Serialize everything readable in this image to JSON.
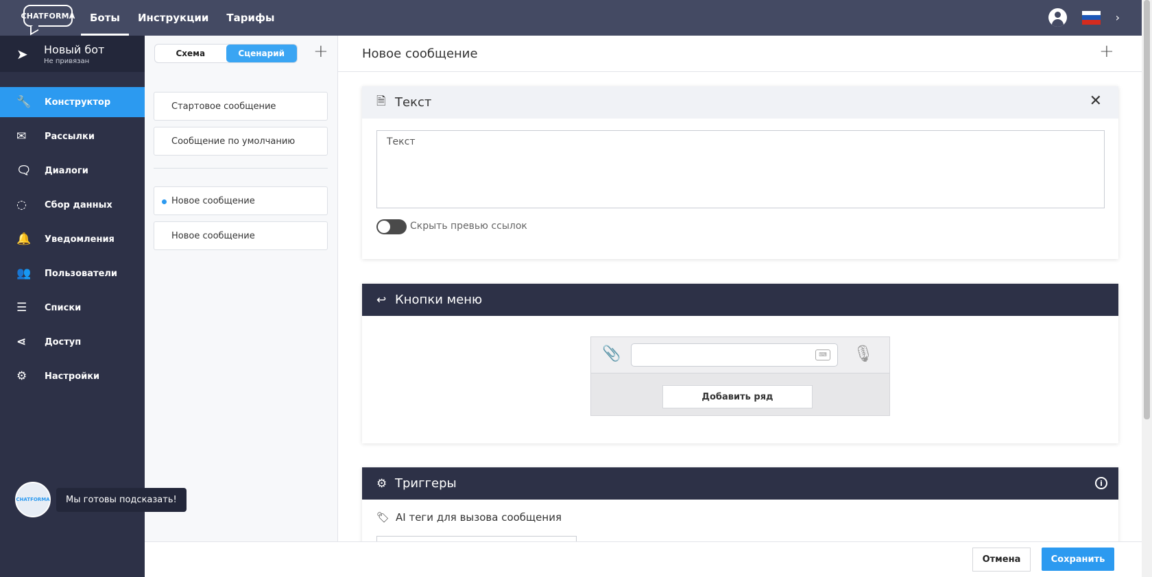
{
  "topbar": {
    "logo_text": "CHATFORMA",
    "nav": [
      {
        "label": "Боты",
        "active": true
      },
      {
        "label": "Инструкции",
        "active": false
      },
      {
        "label": "Тарифы",
        "active": false
      }
    ],
    "flag_colors": [
      "#ffffff",
      "#1c57b8",
      "#d52b1e"
    ],
    "chevron": "›"
  },
  "sidebar": {
    "bot_name": "Новый бот",
    "bot_status": "Не привязан",
    "items": [
      {
        "label": "Конструктор",
        "icon": "wrench-icon",
        "glyph": "🔧",
        "active": true
      },
      {
        "label": "Рассылки",
        "icon": "envelope-icon",
        "glyph": "✉",
        "active": false
      },
      {
        "label": "Диалоги",
        "icon": "chat-icon",
        "glyph": "🗨",
        "active": false
      },
      {
        "label": "Сбор данных",
        "icon": "chart-ring-icon",
        "glyph": "◌",
        "active": false
      },
      {
        "label": "Уведомления",
        "icon": "bell-icon",
        "glyph": "🔔",
        "active": false
      },
      {
        "label": "Пользователи",
        "icon": "users-icon",
        "glyph": "👥",
        "active": false
      },
      {
        "label": "Списки",
        "icon": "list-icon",
        "glyph": "☰",
        "active": false
      },
      {
        "label": "Доступ",
        "icon": "share-icon",
        "glyph": "⋖",
        "active": false
      },
      {
        "label": "Настройки",
        "icon": "gear-icon",
        "glyph": "⚙",
        "active": false
      }
    ],
    "help_avatar_text": "CHATFORMA",
    "help_text": "Мы готовы подсказать!"
  },
  "scenarios": {
    "tabs": [
      {
        "label": "Схема",
        "active": false
      },
      {
        "label": "Сценарий",
        "active": true
      }
    ],
    "system_items": [
      "Стартовое сообщение",
      "Сообщение по умолчанию"
    ],
    "items": [
      {
        "label": "Новое сообщение",
        "active": true
      },
      {
        "label": "Новое сообщение",
        "active": false
      }
    ]
  },
  "main": {
    "title": "Новое сообщение",
    "text_panel": {
      "title": "Текст",
      "textarea_value": "Текст",
      "toggle_label": "Скрыть превью ссылок"
    },
    "menu_panel": {
      "title": "Кнопки меню",
      "add_row_label": "Добавить ряд"
    },
    "triggers_panel": {
      "title": "Триггеры",
      "tags_label": "AI теги для вызова сообщения"
    }
  },
  "footer": {
    "cancel_label": "Отмена",
    "save_label": "Сохранить"
  },
  "colors": {
    "topbar": "#444a63",
    "sidebar": "#2d3147",
    "accent": "#2c9af0"
  }
}
